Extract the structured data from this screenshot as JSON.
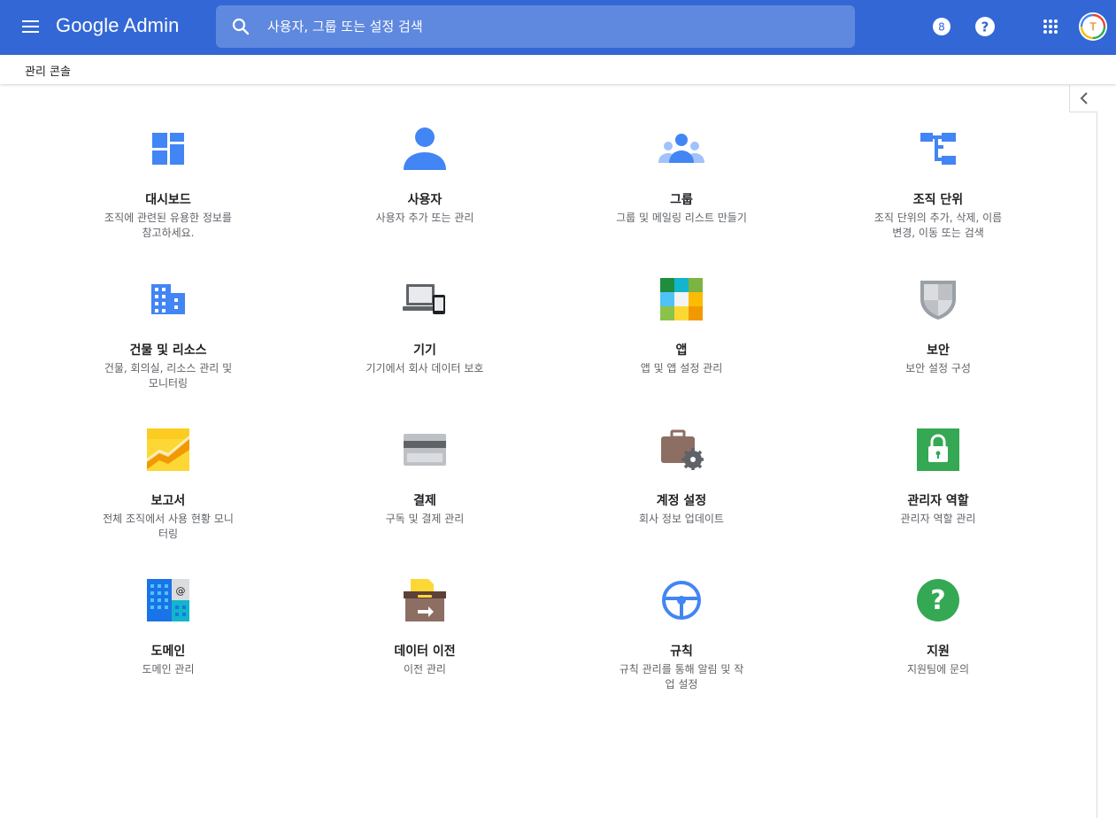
{
  "header": {
    "app_name": "Google Admin",
    "search_placeholder": "사용자, 그룹 또는 설정 검색",
    "badge_digit": "8",
    "avatar_letter": "T"
  },
  "breadcrumb": {
    "title": "관리 콘솔"
  },
  "cards": [
    {
      "title": "대시보드",
      "desc": "조직에 관련된 유용한 정보를 참고하세요.",
      "icon": "dashboard-icon"
    },
    {
      "title": "사용자",
      "desc": "사용자 추가 또는 관리",
      "icon": "user-icon"
    },
    {
      "title": "그룹",
      "desc": "그룹 및 메일링 리스트 만들기",
      "icon": "groups-icon"
    },
    {
      "title": "조직 단위",
      "desc": "조직 단위의 추가, 삭제, 이름 변경, 이동 또는 검색",
      "icon": "org-unit-icon"
    },
    {
      "title": "건물 및 리소스",
      "desc": "건물, 회의실, 리소스 관리 및 모니터링",
      "icon": "building-icon"
    },
    {
      "title": "기기",
      "desc": "기기에서 회사 데이터 보호",
      "icon": "devices-icon"
    },
    {
      "title": "앱",
      "desc": "앱 및 앱 설정 관리",
      "icon": "apps-icon"
    },
    {
      "title": "보안",
      "desc": "보안 설정 구성",
      "icon": "shield-icon"
    },
    {
      "title": "보고서",
      "desc": "전체 조직에서 사용 현황 모니터링",
      "icon": "reports-chart-icon"
    },
    {
      "title": "결제",
      "desc": "구독 및 결제 관리",
      "icon": "credit-card-icon"
    },
    {
      "title": "계정 설정",
      "desc": "회사 정보 업데이트",
      "icon": "briefcase-gear-icon"
    },
    {
      "title": "관리자 역할",
      "desc": "관리자 역할 관리",
      "icon": "lock-icon"
    },
    {
      "title": "도메인",
      "desc": "도메인 관리",
      "icon": "domain-icon"
    },
    {
      "title": "데이터 이전",
      "desc": "이전 관리",
      "icon": "data-migration-icon"
    },
    {
      "title": "규칙",
      "desc": "규칙 관리를 통해 알림 및 작업 설정",
      "icon": "steering-wheel-icon"
    },
    {
      "title": "지원",
      "desc": "지원팀에 문의",
      "icon": "help-icon"
    }
  ],
  "colors": {
    "header_bg": "#3367d6",
    "icon_blue": "#4285f4",
    "text_primary": "#202124",
    "text_secondary": "#5f6368"
  }
}
